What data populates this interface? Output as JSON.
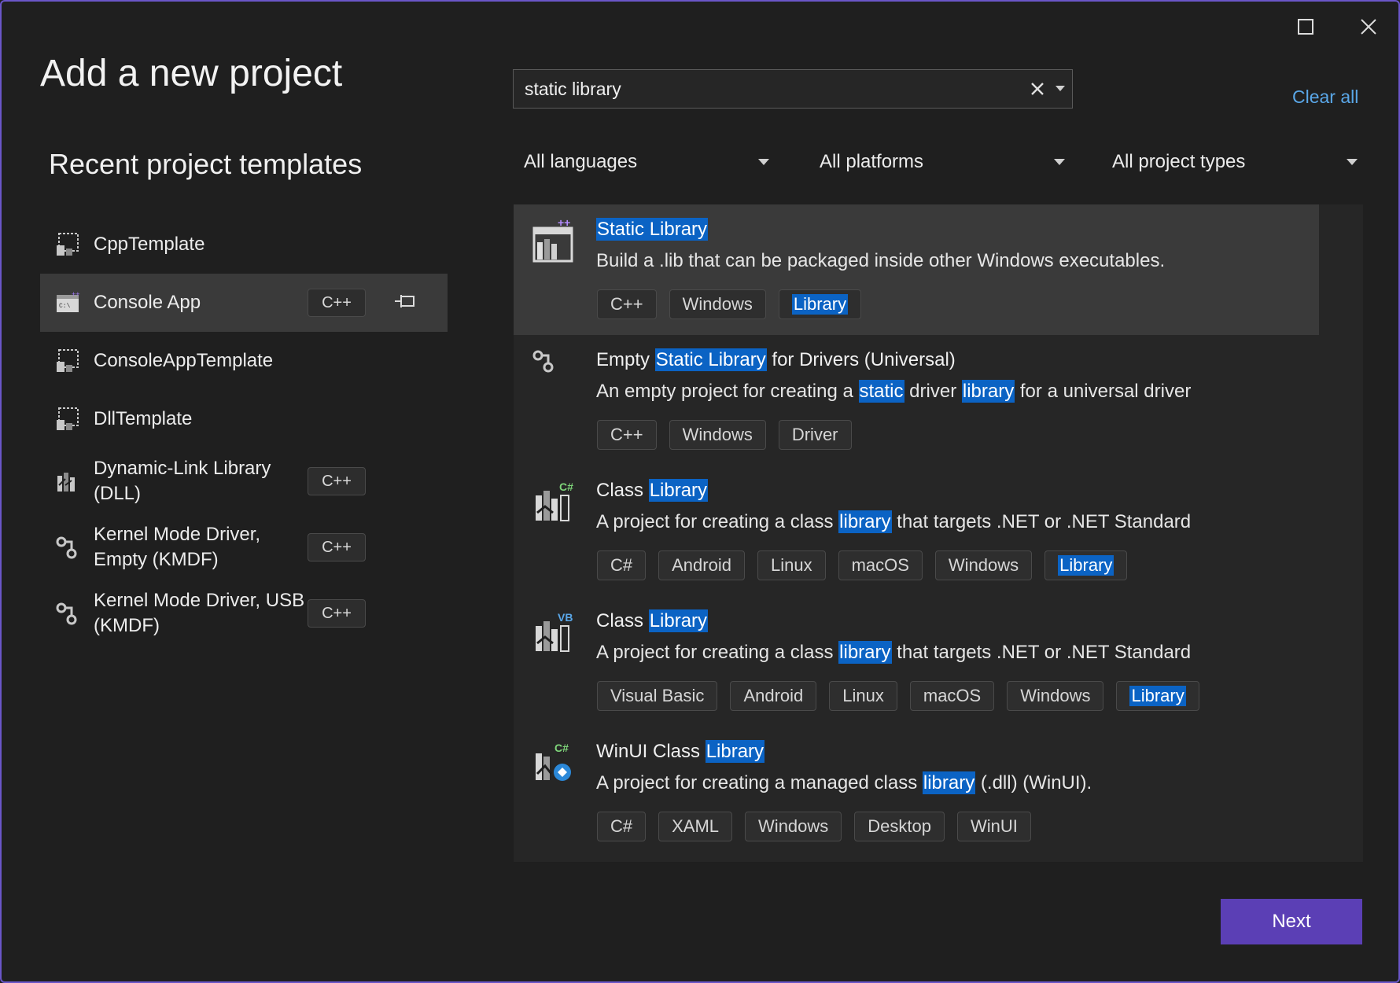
{
  "window": {
    "title": "Add a new project",
    "controls": {
      "maximize_icon": "maximize-icon",
      "close_icon": "close-icon"
    }
  },
  "recent": {
    "heading": "Recent project templates",
    "items": [
      {
        "name": "CppTemplate",
        "icon": "template-icon",
        "lang": ""
      },
      {
        "name": "Console App",
        "icon": "console-app-icon",
        "lang": "C++",
        "selected": true,
        "pin_icon": "pin-icon"
      },
      {
        "name": "ConsoleAppTemplate",
        "icon": "template-icon",
        "lang": ""
      },
      {
        "name": "DllTemplate",
        "icon": "template-icon",
        "lang": ""
      },
      {
        "name": "Dynamic-Link Library (DLL)",
        "icon": "dll-icon",
        "lang": "C++"
      },
      {
        "name": "Kernel Mode Driver, Empty (KMDF)",
        "icon": "driver-icon",
        "lang": "C++"
      },
      {
        "name": "Kernel Mode Driver, USB (KMDF)",
        "icon": "driver-icon",
        "lang": "C++"
      }
    ]
  },
  "search": {
    "value": "static library",
    "clear_icon": "close-icon",
    "dropdown_icon": "chevron-down-icon"
  },
  "clear_all": "Clear all",
  "filters": {
    "languages": "All languages",
    "platforms": "All platforms",
    "project_types": "All project types"
  },
  "results": [
    {
      "title_parts": [
        {
          "t": "Static Library",
          "h": true
        }
      ],
      "desc_parts": [
        {
          "t": "Build a .lib that can be packaged inside other Windows executables.",
          "h": false
        }
      ],
      "tags": [
        {
          "t": "C++"
        },
        {
          "t": "Windows"
        },
        {
          "t": "Library",
          "h": true
        }
      ],
      "icon": "static-library-icon",
      "selected": true
    },
    {
      "title_parts": [
        {
          "t": "Empty ",
          "h": false
        },
        {
          "t": "Static Library",
          "h": true
        },
        {
          "t": " for Drivers (Universal)",
          "h": false
        }
      ],
      "desc_parts": [
        {
          "t": "An empty project for creating a ",
          "h": false
        },
        {
          "t": "static",
          "h": true
        },
        {
          "t": " driver ",
          "h": false
        },
        {
          "t": "library",
          "h": true
        },
        {
          "t": " for a universal driver",
          "h": false
        }
      ],
      "tags": [
        {
          "t": "C++"
        },
        {
          "t": "Windows"
        },
        {
          "t": "Driver"
        }
      ],
      "icon": "driver-icon"
    },
    {
      "title_parts": [
        {
          "t": "Class ",
          "h": false
        },
        {
          "t": "Library",
          "h": true
        }
      ],
      "desc_parts": [
        {
          "t": "A project for creating a class ",
          "h": false
        },
        {
          "t": "library",
          "h": true
        },
        {
          "t": " that targets .NET or .NET Standard",
          "h": false
        }
      ],
      "tags": [
        {
          "t": "C#"
        },
        {
          "t": "Android"
        },
        {
          "t": "Linux"
        },
        {
          "t": "macOS"
        },
        {
          "t": "Windows"
        },
        {
          "t": "Library",
          "h": true
        }
      ],
      "icon": "csharp-class-library-icon"
    },
    {
      "title_parts": [
        {
          "t": "Class ",
          "h": false
        },
        {
          "t": "Library",
          "h": true
        }
      ],
      "desc_parts": [
        {
          "t": "A project for creating a class ",
          "h": false
        },
        {
          "t": "library",
          "h": true
        },
        {
          "t": " that targets .NET or .NET Standard",
          "h": false
        }
      ],
      "tags": [
        {
          "t": "Visual Basic"
        },
        {
          "t": "Android"
        },
        {
          "t": "Linux"
        },
        {
          "t": "macOS"
        },
        {
          "t": "Windows"
        },
        {
          "t": "Library",
          "h": true
        }
      ],
      "icon": "vb-class-library-icon"
    },
    {
      "title_parts": [
        {
          "t": "WinUI Class ",
          "h": false
        },
        {
          "t": "Library",
          "h": true
        }
      ],
      "desc_parts": [
        {
          "t": "A project for creating a managed class ",
          "h": false
        },
        {
          "t": "library",
          "h": true
        },
        {
          "t": " (.dll) (WinUI).",
          "h": false
        }
      ],
      "tags": [
        {
          "t": "C#"
        },
        {
          "t": "XAML"
        },
        {
          "t": "Windows"
        },
        {
          "t": "Desktop"
        },
        {
          "t": "WinUI"
        }
      ],
      "icon": "winui-class-library-icon"
    }
  ],
  "next_label": "Next",
  "colors": {
    "accent": "#5b3fb5",
    "highlight": "#0b63c4",
    "link": "#5aa7e8",
    "border": "#6a56c8"
  }
}
